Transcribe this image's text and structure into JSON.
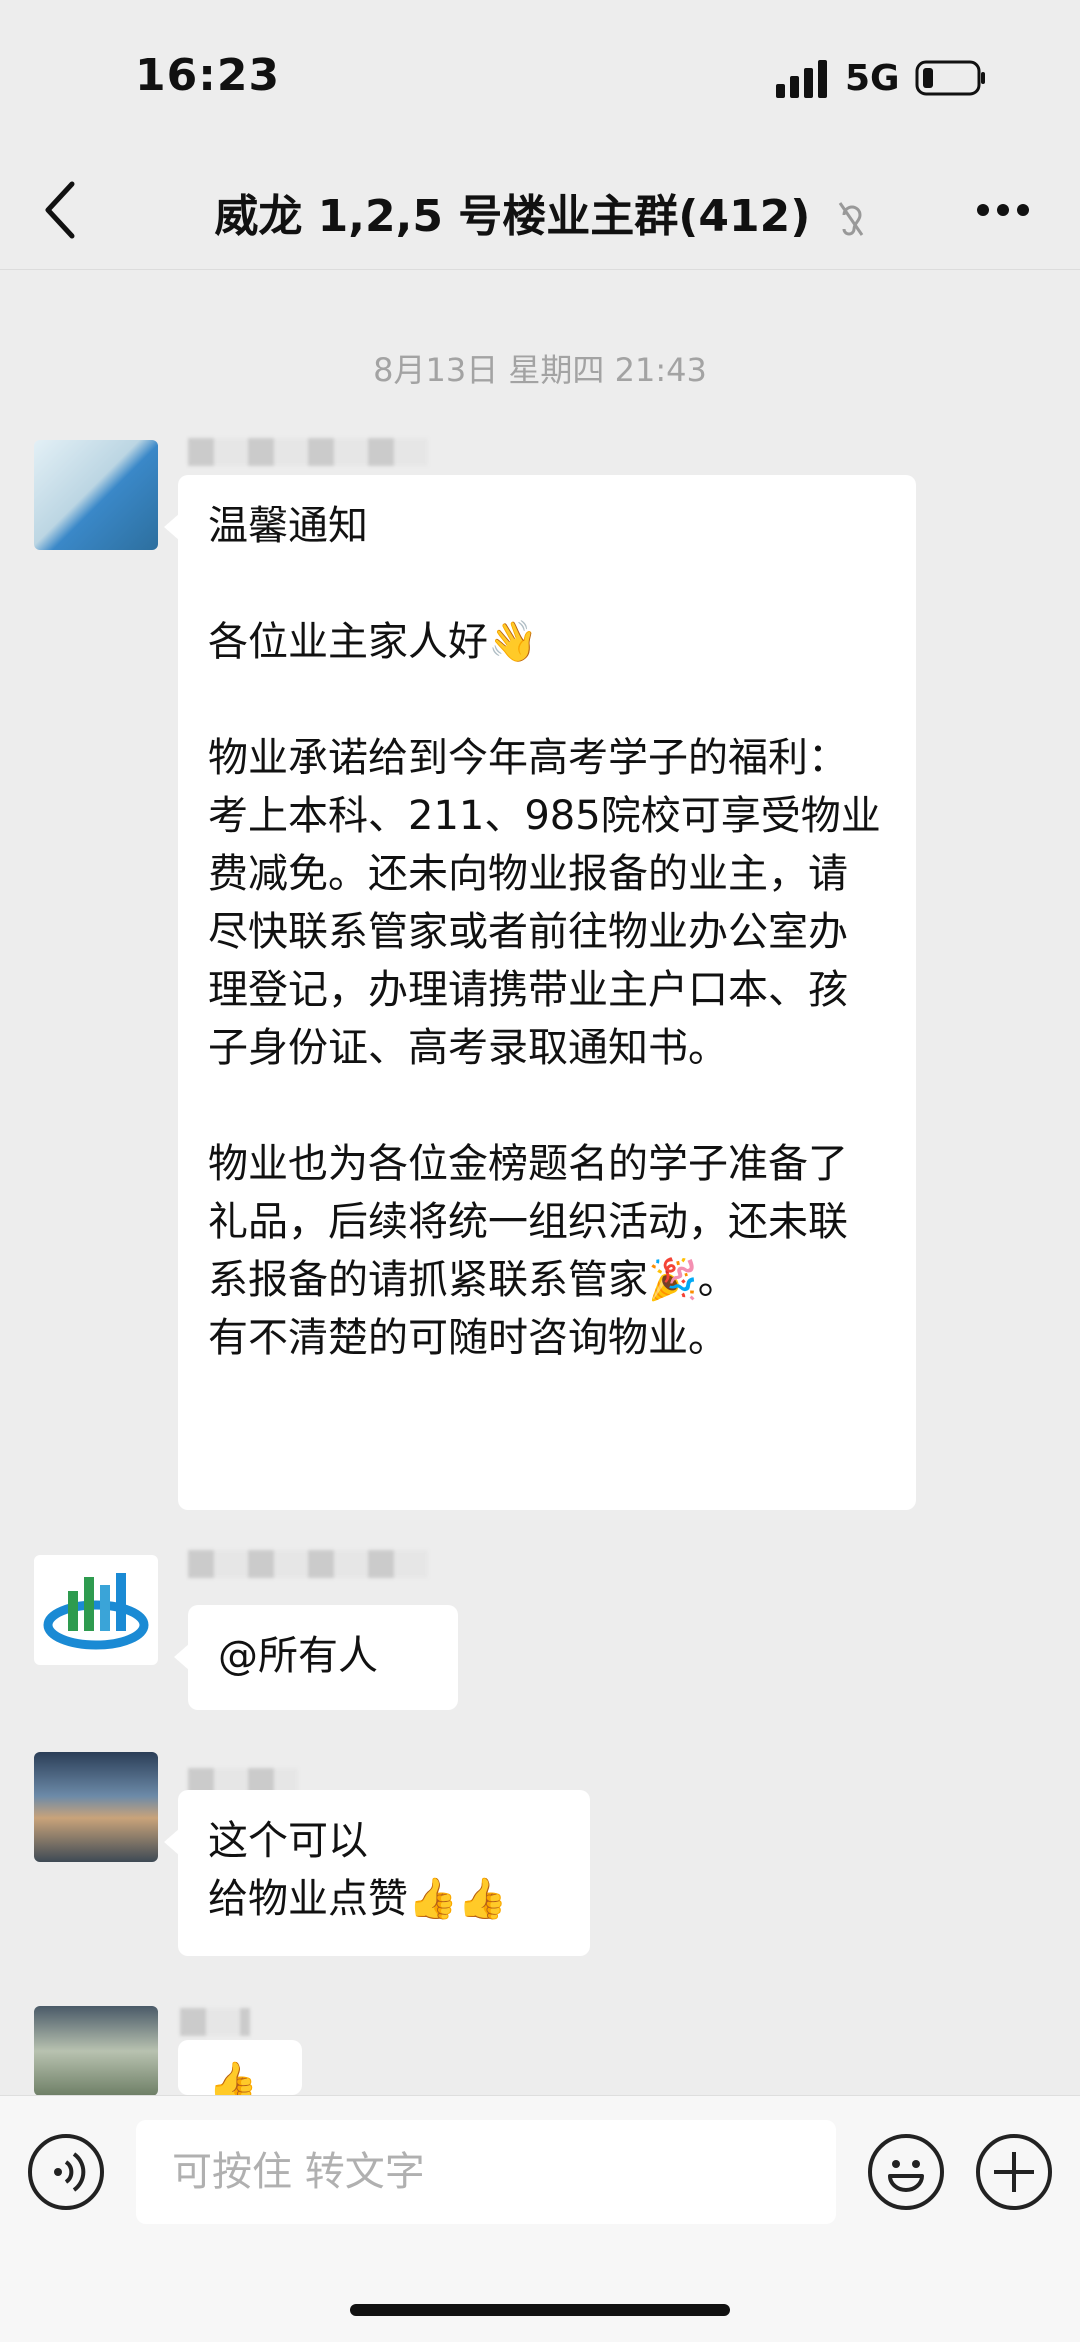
{
  "status_bar": {
    "time": "16:23",
    "network": "5G"
  },
  "header": {
    "title": "威龙 1,2,5 号楼业主群(412)"
  },
  "chat": {
    "timestamp": "8月13日 星期四 21:43",
    "messages": [
      {
        "text": "温馨通知\n\n各位业主家人好👋\n\n物业承诺给到今年高考学子的福利：考上本科、211、985院校可享受物业费减免。还未向物业报备的业主，请尽快联系管家或者前往物业办公室办理登记，办理请携带业主户口本、孩子身份证、高考录取通知书。\n\n物业也为各位金榜题名的学子准备了礼品，后续将统一组织活动，还未联系报备的请抓紧联系管家🎉。\n有不清楚的可随时咨询物业。"
      },
      {
        "text": "@所有人"
      },
      {
        "text": "这个可以\n给物业点赞👍👍"
      },
      {
        "text": "👍"
      }
    ]
  },
  "input_bar": {
    "placeholder": "可按住 转文字"
  },
  "colors": {
    "background": "#ededed",
    "bubble": "#ffffff",
    "accent": "#1a8ad4"
  }
}
